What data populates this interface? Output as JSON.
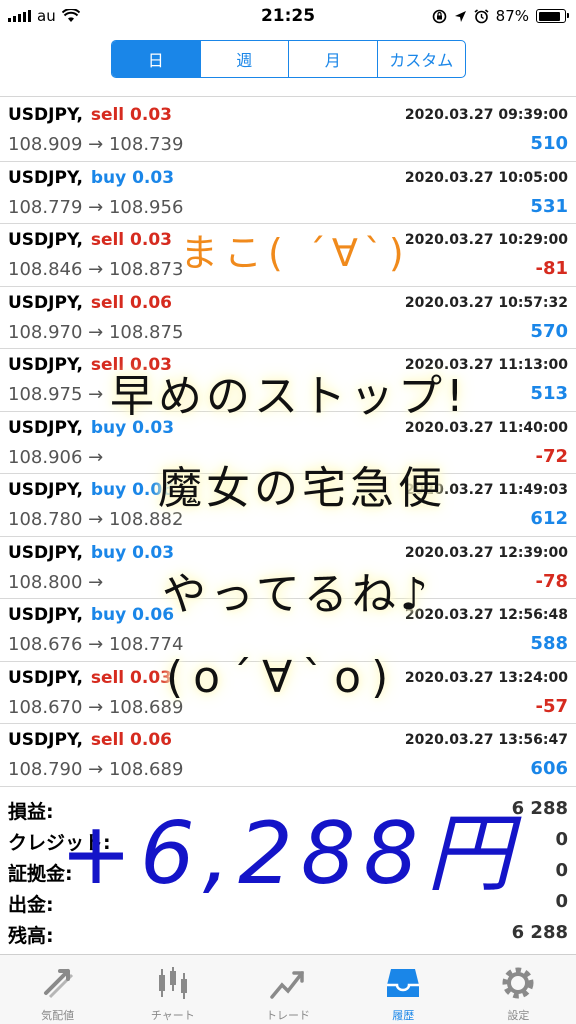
{
  "status": {
    "carrier": "au",
    "time": "21:25",
    "battery": "87%"
  },
  "segments": [
    {
      "label": "日",
      "active": true
    },
    {
      "label": "週",
      "active": false
    },
    {
      "label": "月",
      "active": false
    },
    {
      "label": "カスタム",
      "active": false
    }
  ],
  "trades": [
    {
      "symbol": "USDJPY,",
      "side": "sell",
      "lots": "0.03",
      "open": "108.909",
      "close": "108.739",
      "date": "2020.03.27 09:39:00",
      "profit": "510"
    },
    {
      "symbol": "USDJPY,",
      "side": "buy",
      "lots": "0.03",
      "open": "108.779",
      "close": "108.956",
      "date": "2020.03.27 10:05:00",
      "profit": "531"
    },
    {
      "symbol": "USDJPY,",
      "side": "sell",
      "lots": "0.03",
      "open": "108.846",
      "close": "108.873",
      "date": "2020.03.27 10:29:00",
      "profit": "-81"
    },
    {
      "symbol": "USDJPY,",
      "side": "sell",
      "lots": "0.06",
      "open": "108.970",
      "close": "108.875",
      "date": "2020.03.27 10:57:32",
      "profit": "570"
    },
    {
      "symbol": "USDJPY,",
      "side": "sell",
      "lots": "0.03",
      "open": "108.975",
      "close": "",
      "date": "2020.03.27 11:13:00",
      "profit": "513"
    },
    {
      "symbol": "USDJPY,",
      "side": "buy",
      "lots": "0.03",
      "open": "108.906",
      "close": "",
      "date": "2020.03.27 11:40:00",
      "profit": "-72"
    },
    {
      "symbol": "USDJPY,",
      "side": "buy",
      "lots": "0.06",
      "open": "108.780",
      "close": "108.882",
      "date": "2020.03.27 11:49:03",
      "profit": "612"
    },
    {
      "symbol": "USDJPY,",
      "side": "buy",
      "lots": "0.03",
      "open": "108.800",
      "close": "",
      "date": "2020.03.27 12:39:00",
      "profit": "-78"
    },
    {
      "symbol": "USDJPY,",
      "side": "buy",
      "lots": "0.06",
      "open": "108.676",
      "close": "108.774",
      "date": "2020.03.27 12:56:48",
      "profit": "588"
    },
    {
      "symbol": "USDJPY,",
      "side": "sell",
      "lots": "0.03",
      "open": "108.670",
      "close": "108.689",
      "date": "2020.03.27 13:24:00",
      "profit": "-57"
    },
    {
      "symbol": "USDJPY,",
      "side": "sell",
      "lots": "0.06",
      "open": "108.790",
      "close": "108.689",
      "date": "2020.03.27 13:56:47",
      "profit": "606"
    }
  ],
  "arrow": "→",
  "summary": [
    {
      "label": "損益:",
      "value": "6 288"
    },
    {
      "label": "クレジット:",
      "value": "0"
    },
    {
      "label": "証拠金:",
      "value": "0"
    },
    {
      "label": "出金:",
      "value": "0"
    },
    {
      "label": "残高:",
      "value": "6 288"
    }
  ],
  "tabs": [
    {
      "label": "気配値",
      "icon": "quotes-icon",
      "active": false
    },
    {
      "label": "チャート",
      "icon": "chart-icon",
      "active": false
    },
    {
      "label": "トレード",
      "icon": "trade-icon",
      "active": false
    },
    {
      "label": "履歴",
      "icon": "history-icon",
      "active": true
    },
    {
      "label": "設定",
      "icon": "settings-icon",
      "active": false
    }
  ],
  "annotations": {
    "face_1": "まこ( ´∀`)",
    "line_1": "早めのストップ!",
    "line_2": "魔女の宅急便",
    "line_3": "やってるね♪",
    "face_2": "(o´∀`o)",
    "total": "+6,288円"
  },
  "colors": {
    "accent": "#1a86e8",
    "sell": "#d62b1f",
    "annotation_orange": "#f08a1c",
    "annotation_blue": "#1414c8"
  }
}
